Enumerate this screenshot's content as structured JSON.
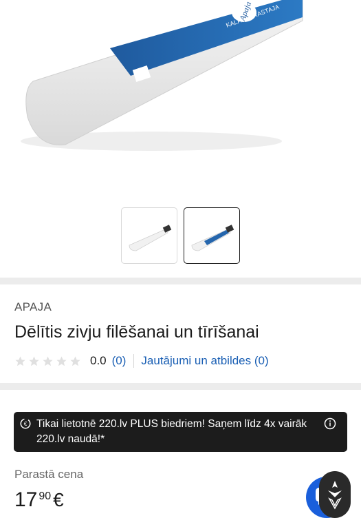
{
  "gallery": {
    "hero_label": "Apaja",
    "thumbnails": [
      {
        "name": "thumbnail-1",
        "active": false
      },
      {
        "name": "thumbnail-2",
        "active": true
      }
    ]
  },
  "product": {
    "brand": "APAJA",
    "title": "Dēlītis zivju filēšanai un tīrīšanai",
    "rating_value": "0.0",
    "rating_count": "(0)",
    "qa_link": "Jautājumi un atbildes (0)"
  },
  "promo_banner": {
    "text": "Tikai lietotnē 220.lv PLUS biedriem! Saņem līdz 4x vairāk 220.lv naudā!*"
  },
  "price": {
    "label": "Parastā cena",
    "integer": "17",
    "decimal": "90",
    "currency": "€"
  },
  "colors": {
    "accent_blue": "#1a5fb4",
    "chat_blue": "#1a5fdb",
    "banner_bg": "#1c1c1c",
    "star_gray": "#e0e0e0"
  }
}
